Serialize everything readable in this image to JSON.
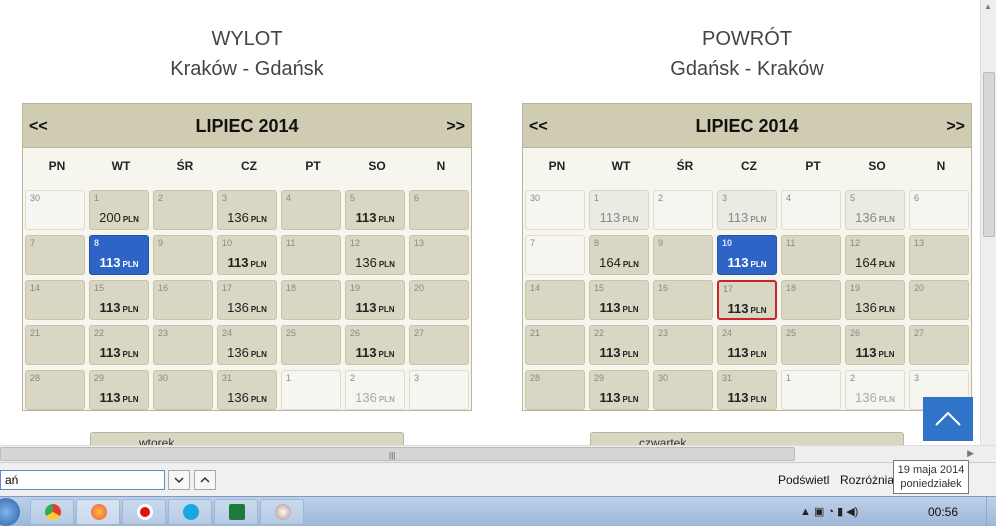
{
  "outbound": {
    "title": "WYLOT",
    "route": "Kraków - Gdańsk",
    "month": "LIPIEC 2014",
    "prev": "<<",
    "next": ">>",
    "weekdays": [
      "PN",
      "WT",
      "ŚR",
      "CZ",
      "PT",
      "SO",
      "N"
    ],
    "currency": "PLN",
    "days": [
      {
        "day": "30",
        "price": "",
        "state": "light"
      },
      {
        "day": "1",
        "price": "200",
        "state": "normal"
      },
      {
        "day": "2",
        "price": "",
        "state": "empty"
      },
      {
        "day": "3",
        "price": "136",
        "state": "normal"
      },
      {
        "day": "4",
        "price": "",
        "state": "empty"
      },
      {
        "day": "5",
        "price": "113",
        "state": "cheap"
      },
      {
        "day": "6",
        "price": "",
        "state": "empty"
      },
      {
        "day": "7",
        "price": "",
        "state": "empty"
      },
      {
        "day": "8",
        "price": "113",
        "state": "selected"
      },
      {
        "day": "9",
        "price": "",
        "state": "empty"
      },
      {
        "day": "10",
        "price": "113",
        "state": "cheap"
      },
      {
        "day": "11",
        "price": "",
        "state": "empty"
      },
      {
        "day": "12",
        "price": "136",
        "state": "normal"
      },
      {
        "day": "13",
        "price": "",
        "state": "empty"
      },
      {
        "day": "14",
        "price": "",
        "state": "empty"
      },
      {
        "day": "15",
        "price": "113",
        "state": "cheap"
      },
      {
        "day": "16",
        "price": "",
        "state": "empty"
      },
      {
        "day": "17",
        "price": "136",
        "state": "normal"
      },
      {
        "day": "18",
        "price": "",
        "state": "empty"
      },
      {
        "day": "19",
        "price": "113",
        "state": "cheap"
      },
      {
        "day": "20",
        "price": "",
        "state": "empty"
      },
      {
        "day": "21",
        "price": "",
        "state": "empty"
      },
      {
        "day": "22",
        "price": "113",
        "state": "cheap"
      },
      {
        "day": "23",
        "price": "",
        "state": "empty"
      },
      {
        "day": "24",
        "price": "136",
        "state": "normal"
      },
      {
        "day": "25",
        "price": "",
        "state": "empty"
      },
      {
        "day": "26",
        "price": "113",
        "state": "cheap"
      },
      {
        "day": "27",
        "price": "",
        "state": "empty"
      },
      {
        "day": "28",
        "price": "",
        "state": "empty"
      },
      {
        "day": "29",
        "price": "113",
        "state": "cheap"
      },
      {
        "day": "30",
        "price": "",
        "state": "empty"
      },
      {
        "day": "31",
        "price": "136",
        "state": "normal"
      },
      {
        "day": "1",
        "price": "",
        "state": "light"
      },
      {
        "day": "2",
        "price": "136",
        "state": "light"
      },
      {
        "day": "3",
        "price": "",
        "state": "light"
      }
    ],
    "day_label": "wtorek"
  },
  "return": {
    "title": "POWRÓT",
    "route": "Gdańsk - Kraków",
    "month": "LIPIEC 2014",
    "prev": "<<",
    "next": ">>",
    "weekdays": [
      "PN",
      "WT",
      "ŚR",
      "CZ",
      "PT",
      "SO",
      "N"
    ],
    "currency": "PLN",
    "days": [
      {
        "day": "30",
        "price": "",
        "state": "light"
      },
      {
        "day": "1",
        "price": "113",
        "state": "faded"
      },
      {
        "day": "2",
        "price": "",
        "state": "light"
      },
      {
        "day": "3",
        "price": "113",
        "state": "faded"
      },
      {
        "day": "4",
        "price": "",
        "state": "light"
      },
      {
        "day": "5",
        "price": "136",
        "state": "faded"
      },
      {
        "day": "6",
        "price": "",
        "state": "light"
      },
      {
        "day": "7",
        "price": "",
        "state": "light"
      },
      {
        "day": "8",
        "price": "164",
        "state": "normal"
      },
      {
        "day": "9",
        "price": "",
        "state": "empty"
      },
      {
        "day": "10",
        "price": "113",
        "state": "selected"
      },
      {
        "day": "11",
        "price": "",
        "state": "empty"
      },
      {
        "day": "12",
        "price": "164",
        "state": "normal"
      },
      {
        "day": "13",
        "price": "",
        "state": "empty"
      },
      {
        "day": "14",
        "price": "",
        "state": "empty"
      },
      {
        "day": "15",
        "price": "113",
        "state": "cheap"
      },
      {
        "day": "16",
        "price": "",
        "state": "empty"
      },
      {
        "day": "17",
        "price": "113",
        "state": "highlight"
      },
      {
        "day": "18",
        "price": "",
        "state": "empty"
      },
      {
        "day": "19",
        "price": "136",
        "state": "normal"
      },
      {
        "day": "20",
        "price": "",
        "state": "empty"
      },
      {
        "day": "21",
        "price": "",
        "state": "empty"
      },
      {
        "day": "22",
        "price": "113",
        "state": "cheap"
      },
      {
        "day": "23",
        "price": "",
        "state": "empty"
      },
      {
        "day": "24",
        "price": "113",
        "state": "cheap"
      },
      {
        "day": "25",
        "price": "",
        "state": "empty"
      },
      {
        "day": "26",
        "price": "113",
        "state": "cheap"
      },
      {
        "day": "27",
        "price": "",
        "state": "empty"
      },
      {
        "day": "28",
        "price": "",
        "state": "empty"
      },
      {
        "day": "29",
        "price": "113",
        "state": "cheap"
      },
      {
        "day": "30",
        "price": "",
        "state": "empty"
      },
      {
        "day": "31",
        "price": "113",
        "state": "cheap"
      },
      {
        "day": "1",
        "price": "",
        "state": "light"
      },
      {
        "day": "2",
        "price": "136",
        "state": "light"
      },
      {
        "day": "3",
        "price": "",
        "state": "light"
      }
    ],
    "day_label": "czwartek"
  },
  "findbar": {
    "query": "ań",
    "highlight_all": "Podświetl",
    "match_case": "Rozróżnia"
  },
  "tooltip": {
    "line1": "19 maja 2014",
    "line2": "poniedziałek"
  },
  "taskbar": {
    "clock": "00:56",
    "apps": [
      "chrome-icon",
      "firefox-icon",
      "opera-icon",
      "skype-icon",
      "excel-icon",
      "paint-icon"
    ]
  },
  "colors": {
    "header_bg": "#cfccb2",
    "cell_bg": "#d9d7c3",
    "selected": "#2e64c5",
    "highlight_border": "#c8262c",
    "scroll_top_button": "#2f74c9"
  }
}
